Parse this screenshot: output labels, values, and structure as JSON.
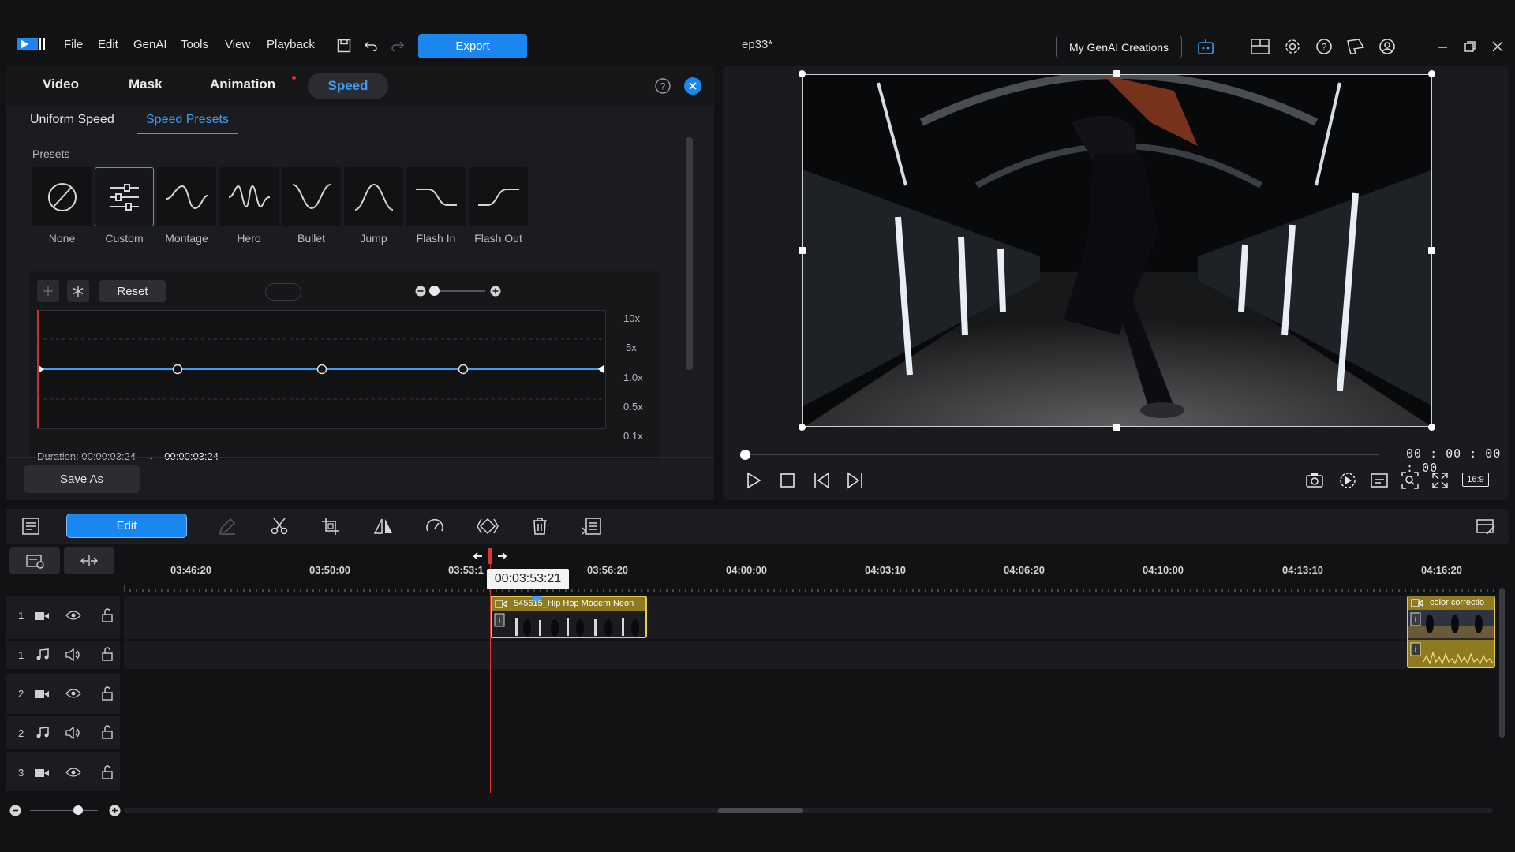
{
  "menu": {
    "file": "File",
    "edit": "Edit",
    "genai": "GenAI",
    "tools": "Tools",
    "view": "View",
    "playback": "Playback"
  },
  "export_label": "Export",
  "document_title": "ep33*",
  "genai_creations_label": "My GenAI Creations",
  "panel_tabs": {
    "video": "Video",
    "mask": "Mask",
    "animation": "Animation",
    "speed": "Speed"
  },
  "subtabs": {
    "uniform": "Uniform Speed",
    "presets": "Speed Presets"
  },
  "presets_heading": "Presets",
  "presets": [
    {
      "label": "None",
      "icon": "none-preset-icon"
    },
    {
      "label": "Custom",
      "icon": "custom-preset-icon"
    },
    {
      "label": "Montage",
      "icon": "montage-curve-icon"
    },
    {
      "label": "Hero",
      "icon": "hero-curve-icon"
    },
    {
      "label": "Bullet",
      "icon": "bullet-curve-icon"
    },
    {
      "label": "Jump",
      "icon": "jump-curve-icon"
    },
    {
      "label": "Flash In",
      "icon": "flash-in-curve-icon"
    },
    {
      "label": "Flash Out",
      "icon": "flash-out-curve-icon"
    }
  ],
  "selected_preset": "Custom",
  "reset_label": "Reset",
  "speed_axis": [
    "10x",
    "5x",
    "1.0x",
    "0.5x",
    "0.1x"
  ],
  "duration_text": "Duration: 00:00:03:24",
  "duration_new": "00:00:03:24",
  "save_as_label": "Save As",
  "preview_timecode": "00 : 00 : 00 : 00",
  "aspect_ratio": "16:9",
  "edit_label": "Edit",
  "ruler_labels": [
    "03:46:20",
    "03:50:00",
    "03:53:1",
    "03:56:20",
    "04:00:00",
    "04:03:10",
    "04:06:20",
    "04:10:00",
    "04:13:10",
    "04:16:20"
  ],
  "playhead_tooltip": "00:03:53:21",
  "tracks": [
    {
      "num": "1",
      "type": "video"
    },
    {
      "num": "1",
      "type": "audio"
    },
    {
      "num": "2",
      "type": "video"
    },
    {
      "num": "2",
      "type": "audio"
    },
    {
      "num": "3",
      "type": "video"
    }
  ],
  "clips": {
    "clip1_title": "545615_Hip Hop Modern Neon",
    "clip2_title": "color correctio"
  },
  "colors": {
    "accent": "#1a86ef",
    "clip_border": "#e9c94a",
    "playhead": "#e0342f"
  }
}
